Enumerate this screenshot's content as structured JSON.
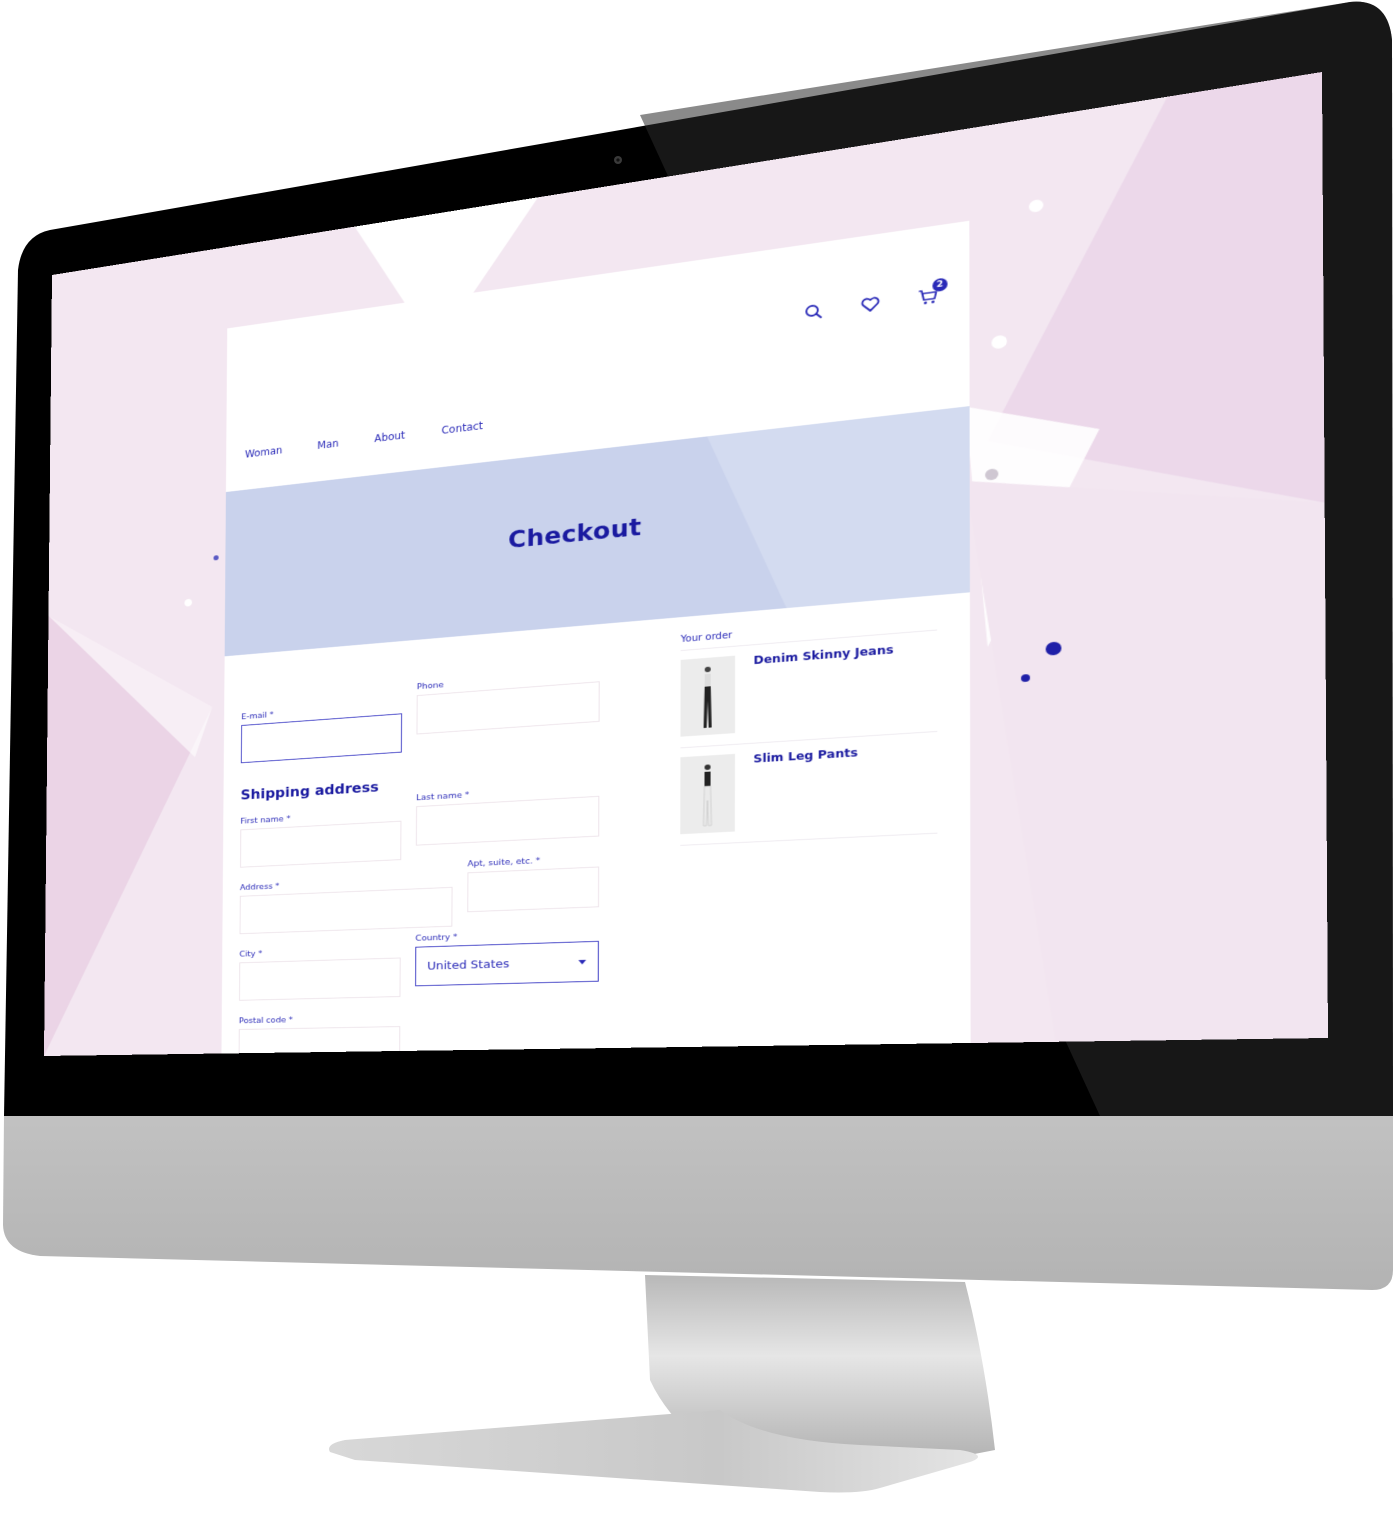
{
  "colors": {
    "accent": "#2a2ab8",
    "heading": "#1a1aa0",
    "hero_bg": "#c9d2ec",
    "screen_bg": "#f3e7f1",
    "bezel": "#000000",
    "chin": "#bdbdbd"
  },
  "nav": {
    "items": [
      {
        "label": "Woman"
      },
      {
        "label": "Man"
      },
      {
        "label": "About"
      },
      {
        "label": "Contact"
      }
    ]
  },
  "header_icons": {
    "search": "search-icon",
    "wishlist": "heart-icon",
    "cart": "cart-icon",
    "cart_count": "2"
  },
  "hero": {
    "title": "Checkout"
  },
  "contact": {
    "email_label": "E-mail *",
    "email_value": "",
    "phone_label": "Phone",
    "phone_value": ""
  },
  "shipping": {
    "title": "Shipping address",
    "first_name_label": "First name *",
    "last_name_label": "Last name *",
    "address_label": "Address *",
    "apt_label": "Apt, suite, etc. *",
    "city_label": "City *",
    "country_label": "Country *",
    "country_value": "United States",
    "postal_label": "Postal code *"
  },
  "order": {
    "heading": "Your order",
    "items": [
      {
        "name": "Denim Skinny Jeans"
      },
      {
        "name": "Slim Leg Pants"
      }
    ]
  }
}
